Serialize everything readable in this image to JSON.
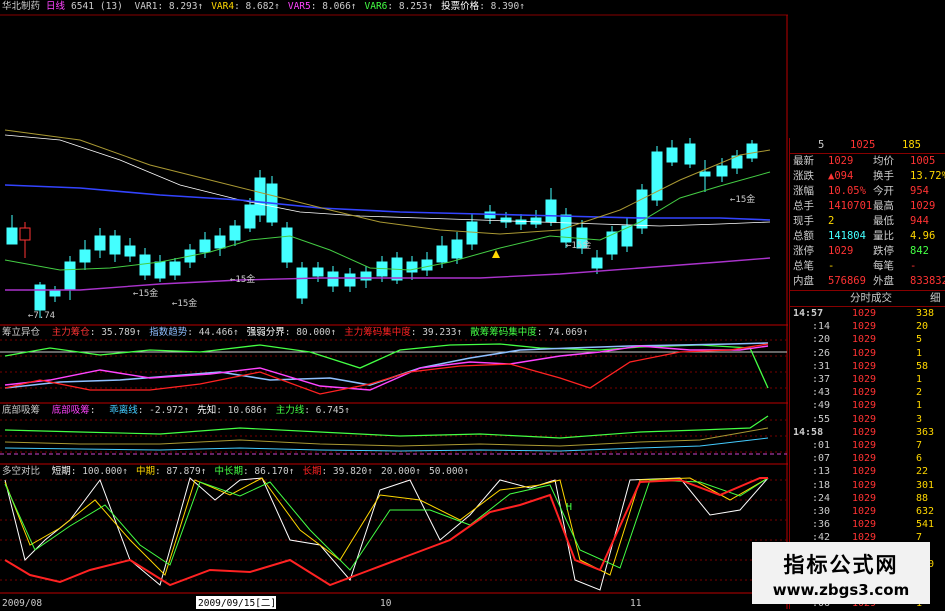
{
  "title_bar": {
    "stock_name": "华北制药",
    "period": "日线",
    "code": "6541",
    "flag": "(13)",
    "indicators": [
      {
        "name": "VAR1",
        "value": "8.293",
        "color": "#cccccc"
      },
      {
        "name": "VAR4",
        "value": "8.682",
        "color": "#ffd700"
      },
      {
        "name": "VAR5",
        "value": "8.066",
        "color": "#ff44ff"
      },
      {
        "name": "VAR6",
        "value": "8.253",
        "color": "#44ff44"
      },
      {
        "name": "投票价格",
        "value": "8.390",
        "color": "#ffffff"
      }
    ]
  },
  "main_chart": {
    "annotations": [
      "15金",
      "15金",
      "15金",
      "15金",
      "15金",
      "7.74"
    ]
  },
  "panel1": {
    "title": "筹立异仓",
    "items": [
      {
        "name": "主力筹仓",
        "value": "35.789",
        "color": "#ff3333"
      },
      {
        "name": "指数趋势",
        "value": "44.466",
        "color": "#8fbfff"
      },
      {
        "name": "强弱分界",
        "value": "80.000",
        "color": "#ffffff"
      },
      {
        "name": "主力筹码集中度",
        "value": "39.233",
        "color": "#ff2222"
      },
      {
        "name": "散筹筹码集中度",
        "value": "74.069",
        "color": "#44ff44"
      }
    ]
  },
  "panel2": {
    "title": "底部吸筹",
    "items": [
      {
        "name": "底部吸筹",
        "value": "",
        "color": "#ff44ff"
      },
      {
        "name": "乖离线",
        "value": "-2.972",
        "color": "#44ccff"
      },
      {
        "name": "先知",
        "value": "10.686",
        "color": "#ffffff"
      },
      {
        "name": "主力线",
        "value": "6.745",
        "color": "#44ff44"
      }
    ]
  },
  "panel3": {
    "title": "多空对比",
    "items": [
      {
        "name": "短期",
        "value": "100.000",
        "color": "#ffffff"
      },
      {
        "name": "中期",
        "value": "87.879",
        "color": "#ffd700"
      },
      {
        "name": "中长期",
        "value": "86.170",
        "color": "#44ff44"
      },
      {
        "name": "长期",
        "value": "39.820",
        "color": "#ff2222"
      },
      {
        "name": "",
        "value": "20.000",
        "color": "#4444ff"
      },
      {
        "name": "",
        "value": "50.000",
        "color": "#ff44ff"
      }
    ],
    "label": "H"
  },
  "date_axis": {
    "labels": [
      "2009/08",
      "2009/09/15[二]",
      "10",
      "11"
    ]
  },
  "quote": {
    "top": [
      "5",
      "1025",
      "185"
    ],
    "rows": [
      {
        "l": "最新",
        "lv": "1029",
        "r": "均价",
        "rv": "1005"
      },
      {
        "l": "涨跌",
        "lv": "▲094",
        "r": "换手",
        "rv": "13.72%"
      },
      {
        "l": "涨幅",
        "lv": "10.05%",
        "r": "今开",
        "rv": "954"
      },
      {
        "l": "总手",
        "lv": "1410701",
        "r": "最高",
        "rv": "1029"
      },
      {
        "l": "现手",
        "lv": "2",
        "r": "最低",
        "rv": "944"
      },
      {
        "l": "总额",
        "lv": "141804",
        "r": "量比",
        "rv": "4.96"
      },
      {
        "l": "涨停",
        "lv": "1029",
        "r": "跌停",
        "rv": "842"
      },
      {
        "l": "总笔",
        "lv": "-",
        "r": "每笔",
        "rv": "-"
      },
      {
        "l": "内盘",
        "lv": "576869",
        "r": "外盘",
        "rv": "833832"
      }
    ],
    "ticks_header": "分时成交",
    "ticks_header_right": "细",
    "ticks": [
      {
        "t": "14:57",
        "p": "1029",
        "v": "338"
      },
      {
        "t": ":14",
        "p": "1029",
        "v": "20"
      },
      {
        "t": ":20",
        "p": "1029",
        "v": "5"
      },
      {
        "t": ":26",
        "p": "1029",
        "v": "1"
      },
      {
        "t": ":31",
        "p": "1029",
        "v": "58"
      },
      {
        "t": ":37",
        "p": "1029",
        "v": "1"
      },
      {
        "t": ":43",
        "p": "1029",
        "v": "2"
      },
      {
        "t": ":49",
        "p": "1029",
        "v": "1"
      },
      {
        "t": ":55",
        "p": "1029",
        "v": "3"
      },
      {
        "t": "14:58",
        "p": "1029",
        "v": "363"
      },
      {
        "t": ":01",
        "p": "1029",
        "v": "7"
      },
      {
        "t": ":07",
        "p": "1029",
        "v": "6"
      },
      {
        "t": ":13",
        "p": "1029",
        "v": "22"
      },
      {
        "t": ":18",
        "p": "1029",
        "v": "301"
      },
      {
        "t": ":24",
        "p": "1029",
        "v": "88"
      },
      {
        "t": ":30",
        "p": "1029",
        "v": "632"
      },
      {
        "t": ":36",
        "p": "1029",
        "v": "541"
      },
      {
        "t": ":42",
        "p": "1029",
        "v": "7"
      },
      {
        "t": ":48",
        "p": "1029",
        "v": "10"
      },
      {
        "t": ":54",
        "p": "1029",
        "v": "240"
      },
      {
        "t": "14:59",
        "p": "1029",
        "v": "1"
      },
      {
        "t": ":00",
        "p": "1029",
        "v": "15"
      },
      {
        "t": ":06",
        "p": "1029",
        "v": "1"
      }
    ]
  },
  "watermark": {
    "line1": "指标公式网",
    "line2": "www.zbgs3.com"
  },
  "colors": {
    "up": "#ff2222",
    "down": "#44ffff",
    "grid": "#880000"
  }
}
